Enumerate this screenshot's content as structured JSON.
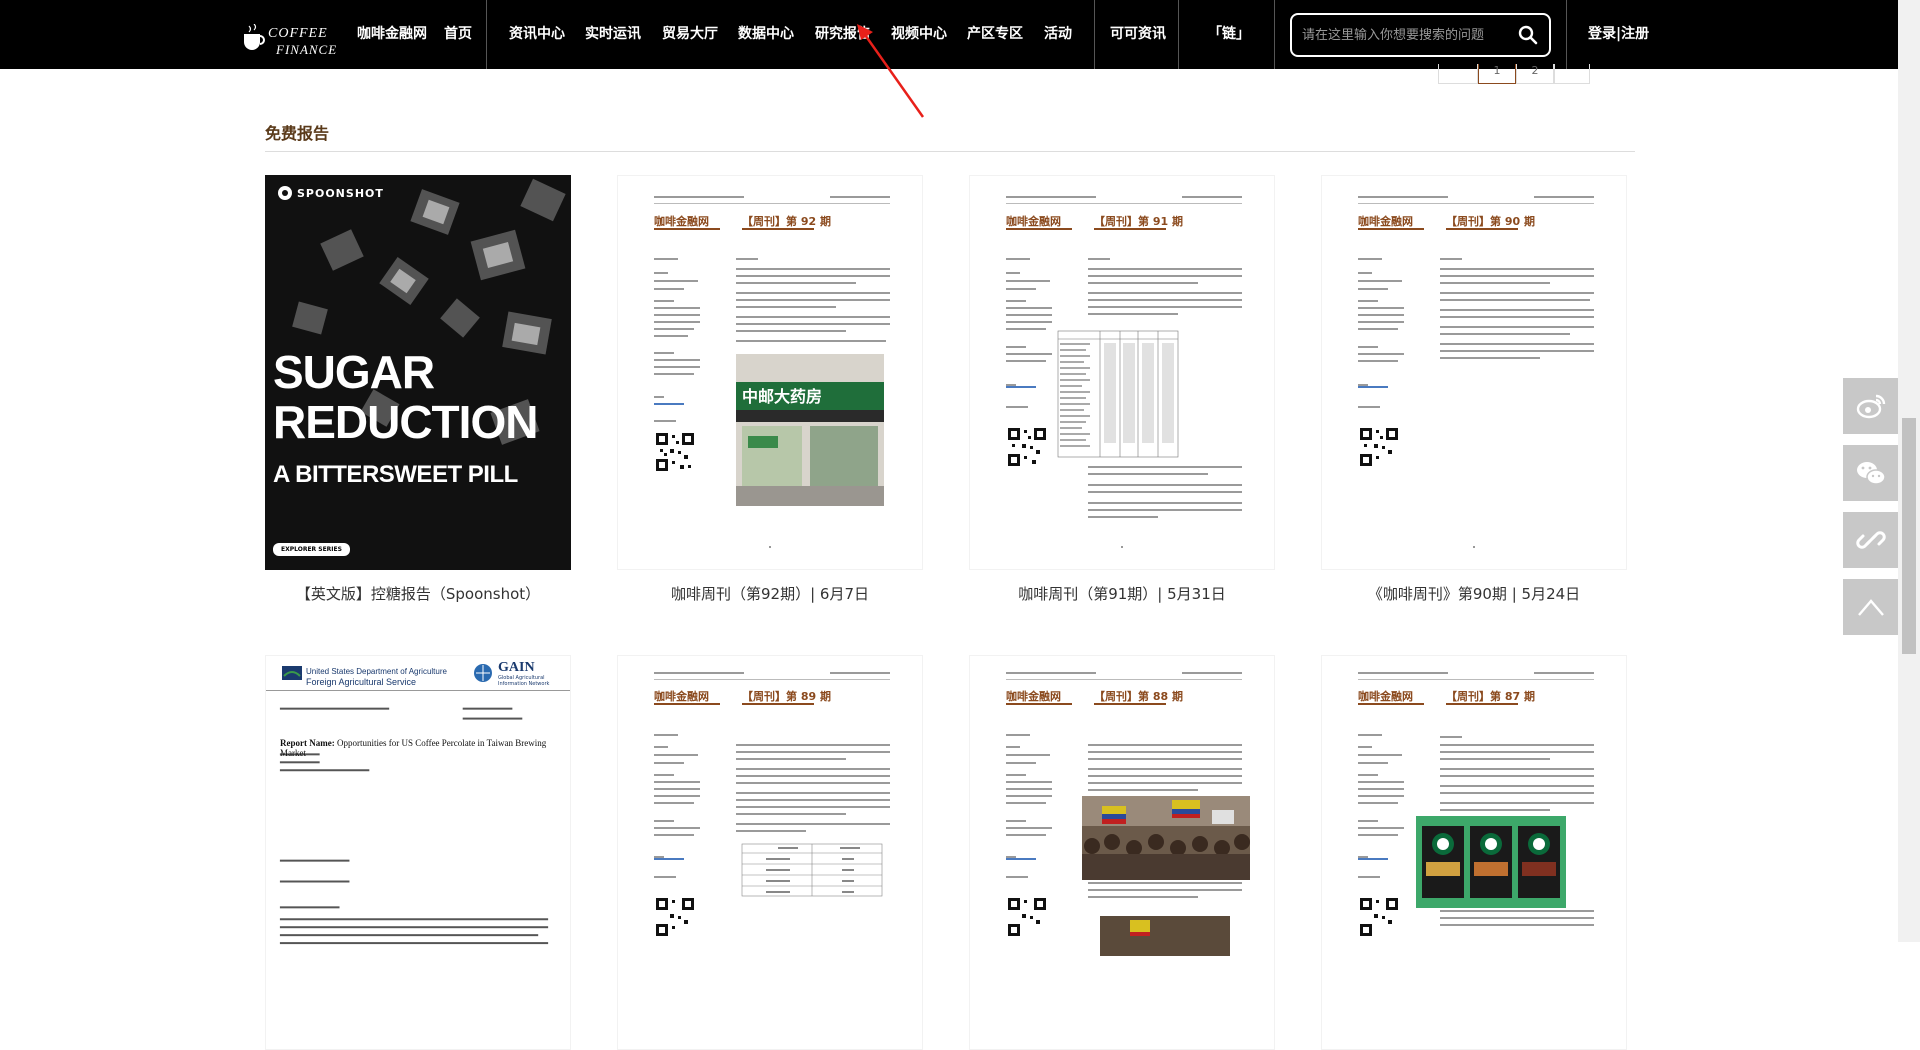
{
  "nav": {
    "logo_line1": "COFFEE",
    "logo_line2": "FINANCE",
    "items": [
      "咖啡金融网",
      "首页",
      "资讯中心",
      "实时运讯",
      "贸易大厅",
      "数据中心",
      "研究报告",
      "视频中心",
      "产区专区",
      "活动",
      "可可资讯",
      "「链」"
    ],
    "search_placeholder": "请在这里输入你想要搜索的问题",
    "login": "登录|注册"
  },
  "pager": [
    "1",
    "2"
  ],
  "section": {
    "title": "免费报告"
  },
  "cover": {
    "brand": "SPOONSHOT",
    "title_line1": "SUGAR",
    "title_line2": "REDUCTION",
    "subtitle": "A BITTERSWEET PILL",
    "series": "EXPLORER SERIES"
  },
  "usda": {
    "agency": "United States Department of Agriculture",
    "service": "Foreign Agricultural Service",
    "gain": "GAIN",
    "gain_sub": "Global Agricultural Information Network",
    "report_name_label": "Report Name:",
    "report_name": "Opportunities for US Coffee Percolate in Taiwan Brewing Market"
  },
  "doc_brand": "咖啡金融网",
  "reports": [
    {
      "caption": "【英文版】控糖报告（Spoonshot）"
    },
    {
      "caption": "咖啡周刊（第92期）| 6月7日",
      "issue": "【周刊】第 92 期"
    },
    {
      "caption": "咖啡周刊（第91期）| 5月31日",
      "issue": "【周刊】第 91 期"
    },
    {
      "caption": "《咖啡周刊》第90期 | 5月24日",
      "issue": "【周刊】第 90 期"
    },
    {
      "caption": "",
      "issue": ""
    },
    {
      "caption": "",
      "issue": "【周刊】第 89 期"
    },
    {
      "caption": "",
      "issue": "【周刊】第 88 期"
    },
    {
      "caption": "",
      "issue": "【周刊】第 87 期"
    }
  ],
  "colors": {
    "nav_bg": "#000000",
    "brand_brown": "#8b4a1e",
    "title_brown": "#5a3a1a",
    "arrow_red": "#e8201a",
    "tool_bg": "#c8c8c8"
  },
  "tools": [
    "weibo-icon",
    "wechat-icon",
    "link-icon",
    "back-to-top-icon"
  ]
}
